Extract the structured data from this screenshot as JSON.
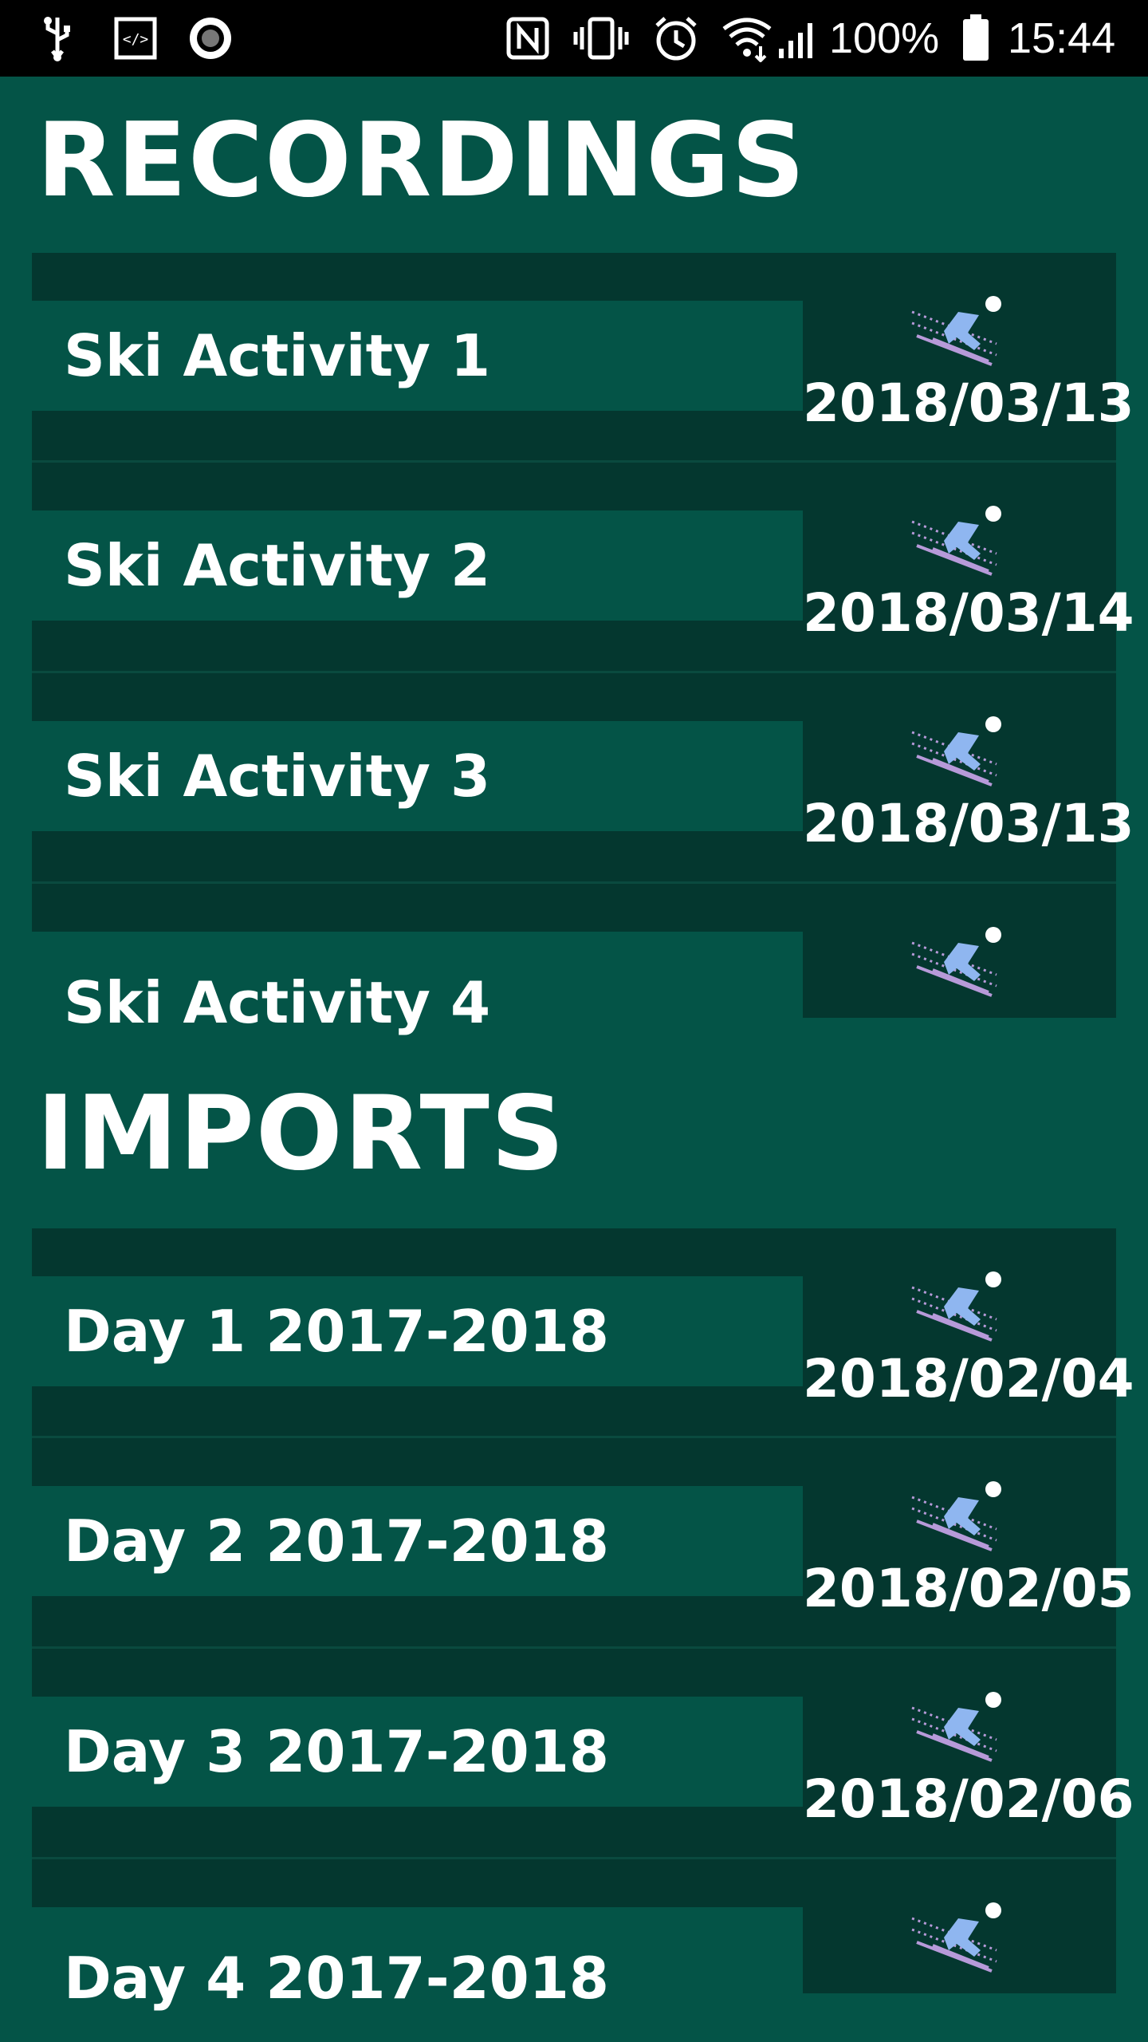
{
  "status_bar": {
    "battery_percent": "100%",
    "time": "15:44",
    "icons": [
      "usb-icon",
      "code-icon",
      "record-icon",
      "nfc-icon",
      "vibrate-icon",
      "alarm-icon",
      "wifi-icon",
      "signal-icon",
      "battery-icon"
    ]
  },
  "sections": {
    "recordings": {
      "title": "RECORDINGS",
      "items": [
        {
          "name": "Ski Activity 1",
          "date": "2018/03/13"
        },
        {
          "name": "Ski Activity 2",
          "date": "2018/03/14"
        },
        {
          "name": "Ski Activity 3",
          "date": "2018/03/13"
        },
        {
          "name": "Ski Activity 4",
          "date": ""
        }
      ]
    },
    "imports": {
      "title": "IMPORTS",
      "items": [
        {
          "name": "Day 1 2017-2018",
          "date": "2018/02/04"
        },
        {
          "name": "Day 2 2017-2018",
          "date": "2018/02/05"
        },
        {
          "name": "Day 3 2017-2018",
          "date": "2018/02/06"
        },
        {
          "name": "Day 4 2017-2018",
          "date": ""
        }
      ]
    }
  },
  "colors": {
    "background": "#045447",
    "row_dark": "#04372f",
    "skier": "#8fb6f0",
    "ski_lines": "#b79ad9"
  }
}
